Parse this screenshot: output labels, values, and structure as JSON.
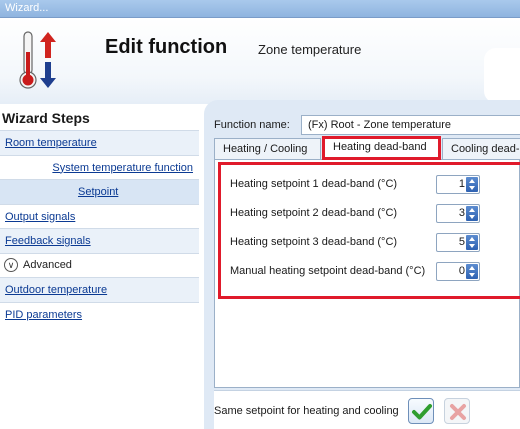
{
  "window": {
    "title": "Wizard..."
  },
  "header": {
    "title": "Edit function",
    "subtitle": "Zone temperature"
  },
  "sidebar": {
    "heading": "Wizard Steps",
    "items": [
      {
        "label": "Room temperature"
      },
      {
        "label": "System temperature function"
      },
      {
        "label": "Setpoint"
      },
      {
        "label": "Output signals"
      },
      {
        "label": "Feedback signals"
      },
      {
        "label": "Advanced"
      },
      {
        "label": "Outdoor temperature"
      },
      {
        "label": "PID parameters"
      }
    ]
  },
  "main": {
    "function_name_label": "Function name:",
    "function_name_value": "(Fx) Root - Zone temperature",
    "tabs": [
      {
        "label": "Heating / Cooling"
      },
      {
        "label": "Heating dead-band"
      },
      {
        "label": "Cooling dead-"
      }
    ],
    "fields": [
      {
        "label": "Heating setpoint 1 dead-band (°C)",
        "value": "1"
      },
      {
        "label": "Heating setpoint 2 dead-band (°C)",
        "value": "3"
      },
      {
        "label": "Heating setpoint 3 dead-band (°C)",
        "value": "5"
      },
      {
        "label": "Manual heating setpoint dead-band (°C)",
        "value": "0"
      }
    ],
    "same_setpoint_label": "Same setpoint for heating and cooling"
  },
  "colors": {
    "highlight": "#e01a2b",
    "link": "#0b3a93",
    "accent": "#2e62b2"
  },
  "icons": [
    "thermometer-icon",
    "up-down-arrow-icon",
    "chevron-down-icon",
    "checkmark-icon",
    "cross-icon"
  ]
}
